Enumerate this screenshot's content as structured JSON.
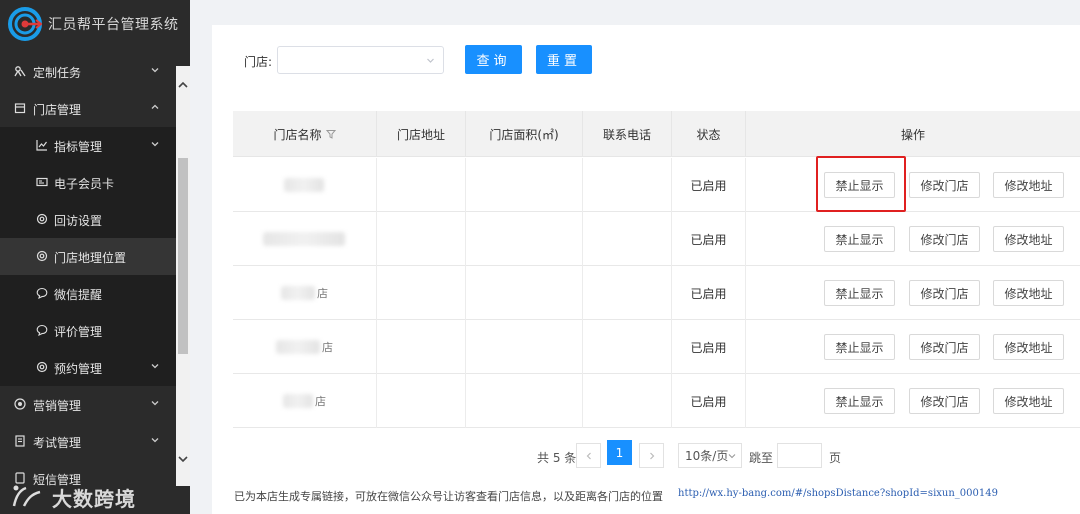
{
  "app": {
    "title": "汇员帮平台管理系统",
    "brand_color": "#1890ff",
    "logo_color": "#1a9ce8"
  },
  "sidebar": {
    "items": [
      {
        "label": "定制任务",
        "icon": "tasks-icon",
        "expanded": false
      },
      {
        "label": "门店管理",
        "icon": "store-icon",
        "expanded": true,
        "children": [
          {
            "label": "指标管理",
            "icon": "chart-line-icon",
            "has_children": true
          },
          {
            "label": "电子会员卡",
            "icon": "member-card-icon"
          },
          {
            "label": "回访设置",
            "icon": "settings-icon"
          },
          {
            "label": "门店地理位置",
            "icon": "settings-icon",
            "active": true
          },
          {
            "label": "微信提醒",
            "icon": "chat-icon"
          },
          {
            "label": "评价管理",
            "icon": "chat-icon"
          },
          {
            "label": "预约管理",
            "icon": "settings-icon",
            "has_children": true
          }
        ]
      },
      {
        "label": "营销管理",
        "icon": "marketing-icon",
        "expanded": false
      },
      {
        "label": "考试管理",
        "icon": "exam-icon",
        "expanded": false
      },
      {
        "label": "短信管理",
        "icon": "sms-icon",
        "expanded": false
      }
    ]
  },
  "filter": {
    "store_label": "门店:",
    "store_value": "",
    "query_label": "查询",
    "reset_label": "重置"
  },
  "table": {
    "columns": [
      "门店名称",
      "门店地址",
      "门店面积(㎡)",
      "联系电话",
      "状态",
      "操作"
    ],
    "rows": [
      {
        "name_tail": "",
        "address": "",
        "area": "",
        "phone": "",
        "status": "已启用"
      },
      {
        "name_tail": "",
        "address": "",
        "area": "",
        "phone": "",
        "status": "已启用"
      },
      {
        "name_tail": "店",
        "address": "",
        "area": "",
        "phone": "",
        "status": "已启用"
      },
      {
        "name_tail": "店",
        "address": "",
        "area": "",
        "phone": "",
        "status": "已启用"
      },
      {
        "name_tail": "店",
        "address": "",
        "area": "",
        "phone": "",
        "status": "已启用"
      }
    ],
    "actions": {
      "hide": "禁止显示",
      "edit_store": "修改门店",
      "edit_address": "修改地址"
    },
    "highlight_color": "#e02020"
  },
  "pagination": {
    "total": "共 5 条",
    "current": "1",
    "page_size": "10条/页",
    "jump_label": "跳至",
    "page_label": "页"
  },
  "footer": {
    "note": "已为本店生成专属链接，可放在微信公众号让访客查看门店信息，以及距离各门店的位置",
    "link": "http://wx.hy-bang.com/#/shopsDistance?shopId=sixun_000149"
  },
  "watermark": {
    "text": "大数跨境"
  }
}
